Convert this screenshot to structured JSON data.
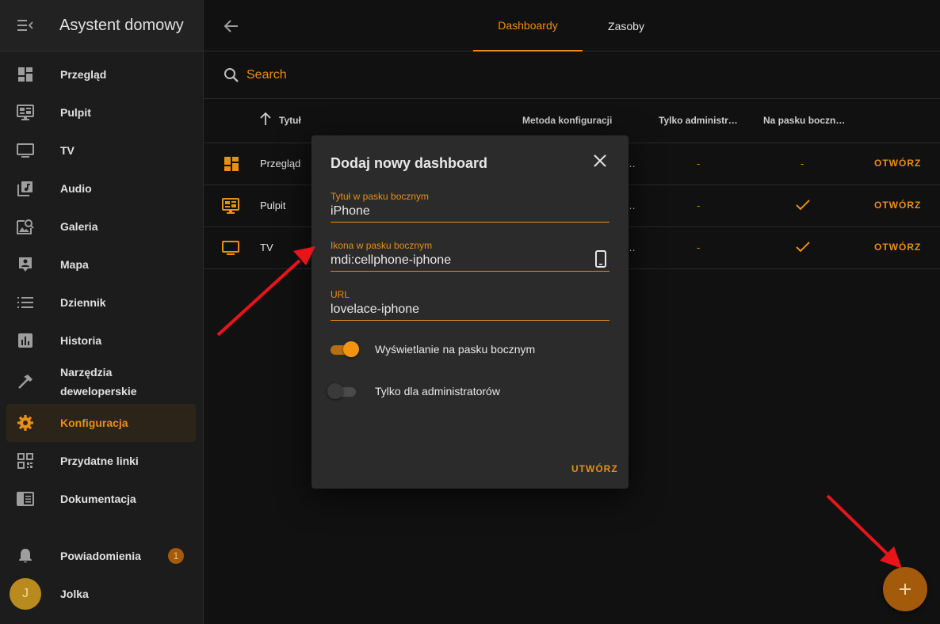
{
  "sidebar": {
    "title": "Asystent domowy",
    "items": [
      {
        "label": "Przegląd",
        "icon": "view-dashboard-icon"
      },
      {
        "label": "Pulpit",
        "icon": "monitor-dashboard-icon"
      },
      {
        "label": "TV",
        "icon": "television-icon"
      },
      {
        "label": "Audio",
        "icon": "music-box-multiple-icon"
      },
      {
        "label": "Galeria",
        "icon": "image-search-icon"
      },
      {
        "label": "Mapa",
        "icon": "map-account-icon"
      },
      {
        "label": "Dziennik",
        "icon": "format-list-bulleted-icon"
      },
      {
        "label": "Historia",
        "icon": "chart-box-icon"
      },
      {
        "label_line1": "Narzędzia",
        "label_line2": "deweloperskie",
        "icon": "hammer-icon"
      },
      {
        "label": "Konfiguracja",
        "icon": "cog-icon",
        "active": true
      },
      {
        "label": "Przydatne linki",
        "icon": "qrcode-icon"
      },
      {
        "label": "Dokumentacja",
        "icon": "book-open-icon"
      }
    ],
    "notifications": {
      "label": "Powiadomienia",
      "count": "1"
    },
    "user": {
      "name": "Jolka",
      "initial": "J"
    }
  },
  "topbar": {
    "tabs": [
      {
        "label": "Dashboardy",
        "active": true
      },
      {
        "label": "Zasoby"
      }
    ]
  },
  "search": {
    "placeholder": "Search"
  },
  "table": {
    "columns": [
      "Tytuł",
      "Metoda konfiguracji",
      "Tylko administr…",
      "Na pasku boczn…"
    ],
    "rows": [
      {
        "title": "Przegląd",
        "method": "…",
        "admin": "-",
        "sidebar": "-",
        "action": "OTWÓRZ",
        "icon": "view-dashboard-icon"
      },
      {
        "title": "Pulpit",
        "method": "…",
        "admin": "-",
        "sidebar": "check",
        "action": "OTWÓRZ",
        "icon": "monitor-dashboard-icon"
      },
      {
        "title": "TV",
        "method": "…",
        "admin": "-",
        "sidebar": "check",
        "action": "OTWÓRZ",
        "icon": "television-icon"
      }
    ]
  },
  "dialog": {
    "title": "Dodaj nowy dashboard",
    "fields": {
      "sidebar_title": {
        "label": "Tytuł w pasku bocznym",
        "value": "iPhone"
      },
      "sidebar_icon": {
        "label": "Ikona w pasku bocznym",
        "value": "mdi:cellphone-iphone"
      },
      "url": {
        "label": "URL",
        "value": "lovelace-iphone"
      }
    },
    "toggles": {
      "show_in_sidebar": {
        "label": "Wyświetlanie na pasku bocznym",
        "on": true
      },
      "admin_only": {
        "label": "Tylko dla administratorów",
        "on": false
      }
    },
    "action": "UTWÓRZ"
  },
  "colors": {
    "accent": "#e88f14",
    "sidebar_bg": "#1c1c1c",
    "main_bg": "#111111",
    "dialog_bg": "#2b2b2b",
    "annotation_arrow": "#e8141a"
  }
}
